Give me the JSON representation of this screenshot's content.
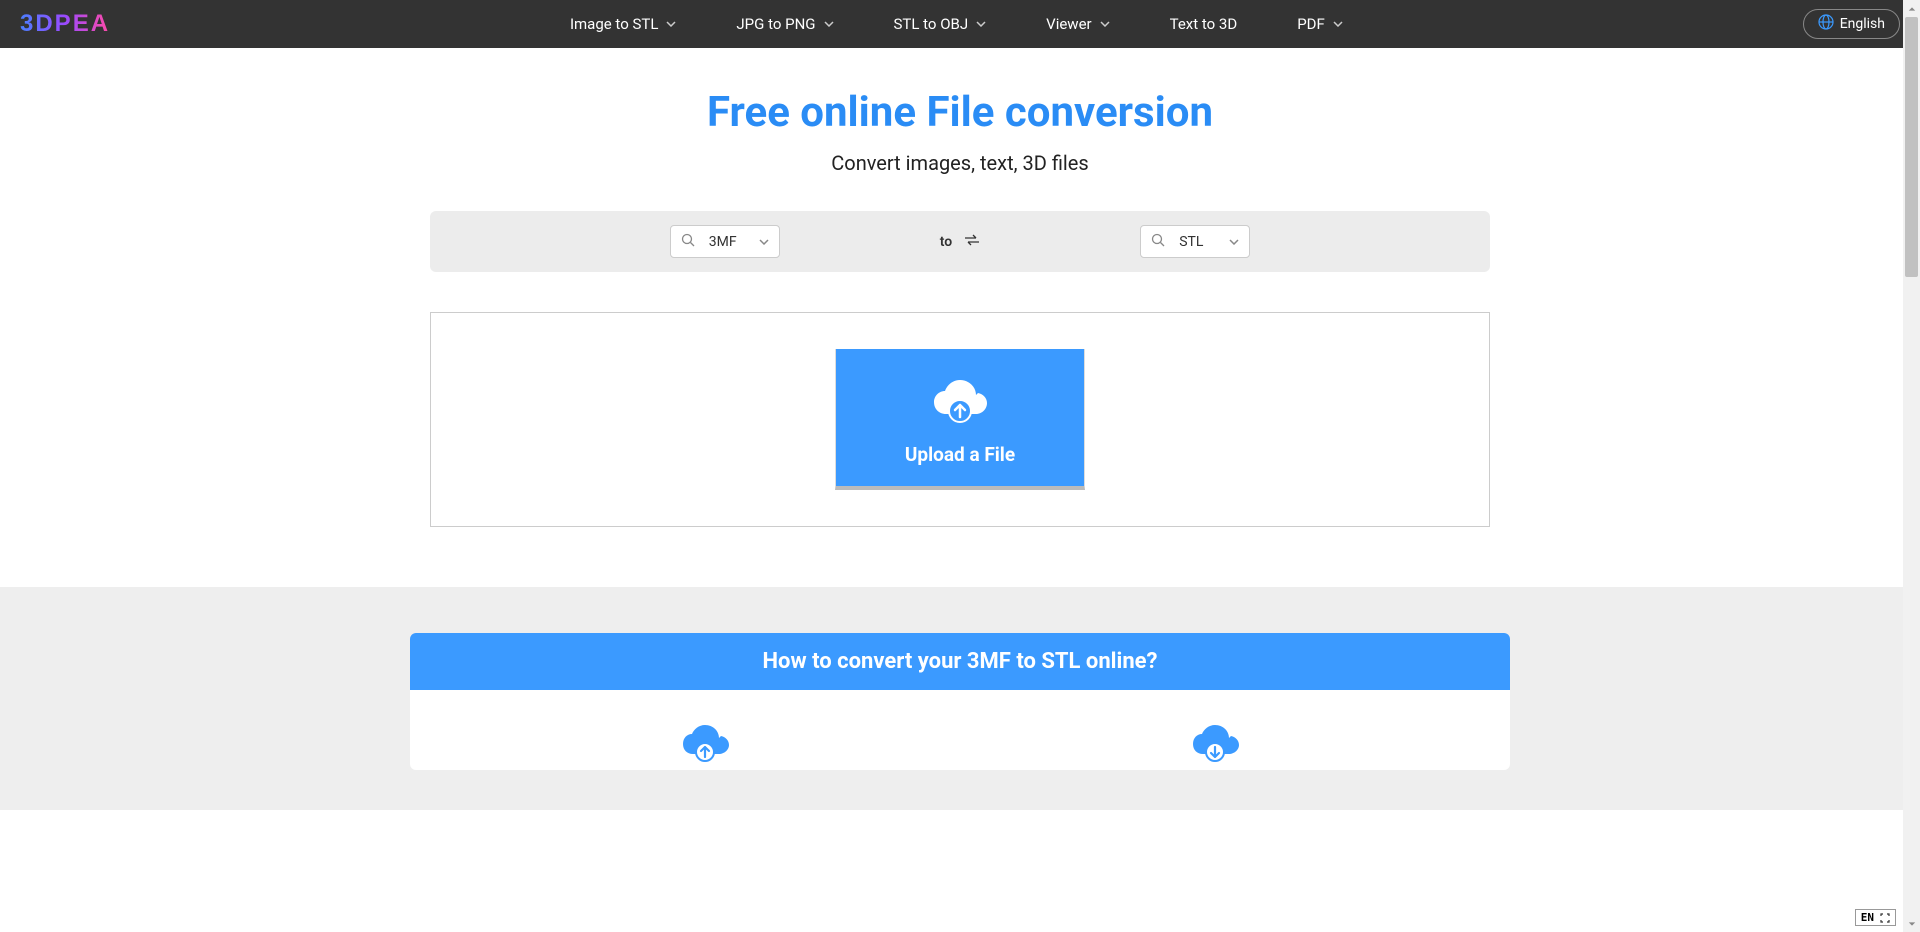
{
  "header": {
    "logo": "3DPEA",
    "nav": [
      {
        "label": "Image to STL",
        "dropdown": true
      },
      {
        "label": "JPG to PNG",
        "dropdown": true
      },
      {
        "label": "STL to OBJ",
        "dropdown": true
      },
      {
        "label": "Viewer",
        "dropdown": true
      },
      {
        "label": "Text to 3D",
        "dropdown": false
      },
      {
        "label": "PDF",
        "dropdown": true
      }
    ],
    "language": "English"
  },
  "hero": {
    "title": "Free online File conversion",
    "subtitle": "Convert images, text, 3D files"
  },
  "converter": {
    "from": "3MF",
    "to_label": "to",
    "to": "STL"
  },
  "upload": {
    "button_label": "Upload a File"
  },
  "howto": {
    "title": "How to convert your 3MF to STL online?"
  },
  "lang_indicator": "EN"
}
